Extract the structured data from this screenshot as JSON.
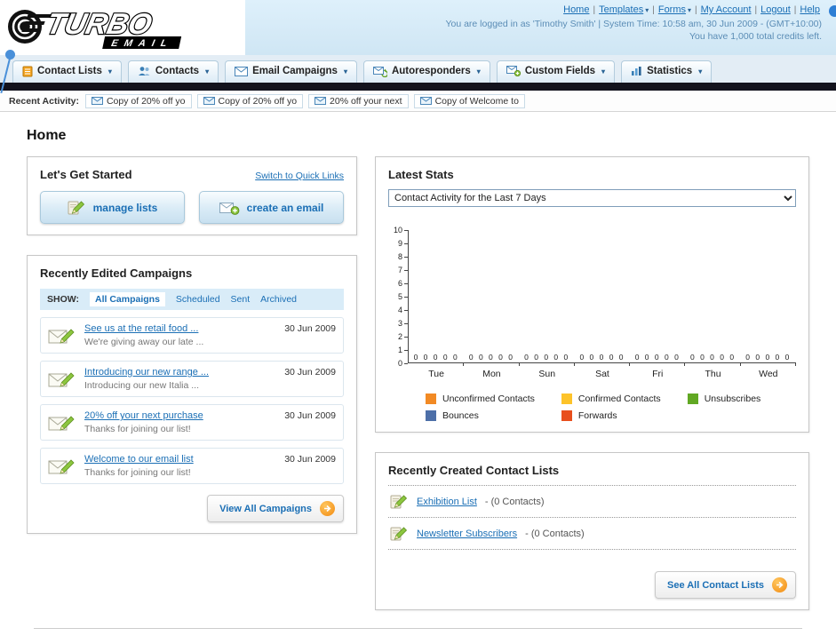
{
  "header": {
    "logo_line1": "TURBO",
    "logo_line2": "EMAIL",
    "nav_links": [
      {
        "label": "Home",
        "dropdown": false
      },
      {
        "label": "Templates",
        "dropdown": true
      },
      {
        "label": "Forms",
        "dropdown": true
      },
      {
        "label": "My Account",
        "dropdown": false
      },
      {
        "label": "Logout",
        "dropdown": false
      },
      {
        "label": "Help",
        "dropdown": false
      }
    ],
    "login_info": "You are logged in as 'Timothy Smith' | System Time: 10:58 am, 30 Jun 2009 - (GMT+10:00)",
    "credits_info": "You have 1,000 total credits left."
  },
  "main_nav": [
    {
      "label": "Contact Lists",
      "icon": "contact-lists-icon"
    },
    {
      "label": "Contacts",
      "icon": "contacts-icon"
    },
    {
      "label": "Email Campaigns",
      "icon": "email-campaigns-icon"
    },
    {
      "label": "Autoresponders",
      "icon": "autoresponders-icon"
    },
    {
      "label": "Custom Fields",
      "icon": "custom-fields-icon"
    },
    {
      "label": "Statistics",
      "icon": "statistics-icon"
    }
  ],
  "recent_activity": {
    "label": "Recent Activity:",
    "items": [
      "Copy of 20% off yo",
      "Copy of 20% off yo",
      "20% off your next",
      "Copy of Welcome to"
    ]
  },
  "page_title": "Home",
  "get_started": {
    "title": "Let's Get Started",
    "switch_link": "Switch to Quick Links",
    "buttons": [
      {
        "label": "manage lists",
        "icon": "edit-list-icon"
      },
      {
        "label": "create an email",
        "icon": "envelope-plus-icon"
      }
    ]
  },
  "campaigns": {
    "title": "Recently Edited Campaigns",
    "show_label": "SHOW:",
    "filters": [
      "All Campaigns",
      "Scheduled",
      "Sent",
      "Archived"
    ],
    "items": [
      {
        "title": "See us at the retail food ...",
        "subtitle": "We're giving away our late ...",
        "date": "30 Jun 2009"
      },
      {
        "title": "Introducing our new range ...",
        "subtitle": "Introducing our new Italia ...",
        "date": "30 Jun 2009"
      },
      {
        "title": "20% off your next purchase",
        "subtitle": "Thanks for joining our list!",
        "date": "30 Jun 2009"
      },
      {
        "title": "Welcome to our email list",
        "subtitle": "Thanks for joining our list!",
        "date": "30 Jun 2009"
      }
    ],
    "view_all_label": "View All Campaigns"
  },
  "latest_stats": {
    "title": "Latest Stats",
    "dropdown_value": "Contact Activity for the Last 7 Days"
  },
  "chart_data": {
    "type": "bar",
    "title": "Contact Activity for the Last 7 Days",
    "categories": [
      "Tue",
      "Mon",
      "Sun",
      "Sat",
      "Fri",
      "Thu",
      "Wed"
    ],
    "series": [
      {
        "name": "Unconfirmed Contacts",
        "color": "#f28a24",
        "values": [
          0,
          0,
          0,
          0,
          0,
          0,
          0
        ]
      },
      {
        "name": "Confirmed Contacts",
        "color": "#fdc32a",
        "values": [
          0,
          0,
          0,
          0,
          0,
          0,
          0
        ]
      },
      {
        "name": "Unsubscribes",
        "color": "#61a823",
        "values": [
          0,
          0,
          0,
          0,
          0,
          0,
          0
        ]
      },
      {
        "name": "Bounces",
        "color": "#4d6fa8",
        "values": [
          0,
          0,
          0,
          0,
          0,
          0,
          0
        ]
      },
      {
        "name": "Forwards",
        "color": "#e84f1d",
        "values": [
          0,
          0,
          0,
          0,
          0,
          0,
          0
        ]
      }
    ],
    "ylim": [
      0,
      10
    ],
    "yticks": [
      0,
      1,
      2,
      3,
      4,
      5,
      6,
      7,
      8,
      9,
      10
    ],
    "grid": false,
    "legend_position": "bottom"
  },
  "contact_lists": {
    "title": "Recently Created Contact Lists",
    "items": [
      {
        "name": "Exhibition List",
        "detail": "- (0 Contacts)"
      },
      {
        "name": "Newsletter Subscribers",
        "detail": "- (0 Contacts)"
      }
    ],
    "see_all_label": "See All Contact Lists"
  }
}
